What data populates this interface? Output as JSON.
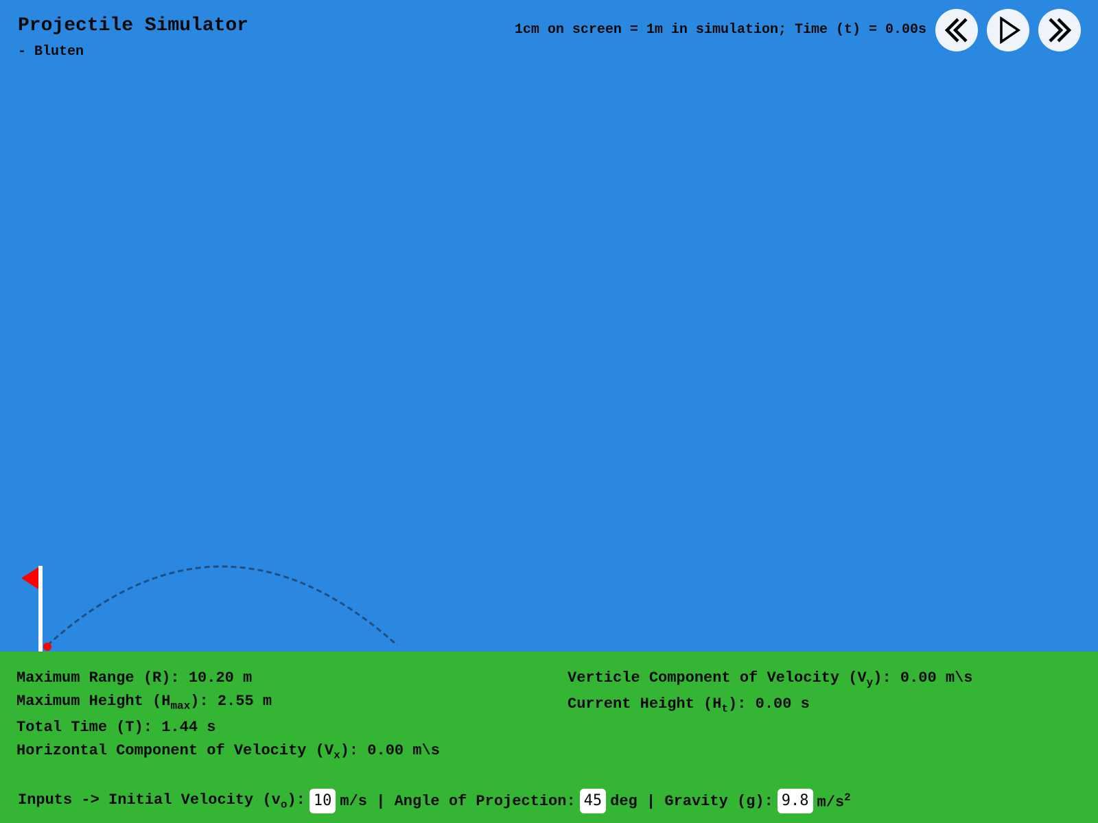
{
  "header": {
    "title": "Projectile Simulator",
    "author": "- Bluten",
    "status": "1cm on screen = 1m in simulation; Time (t) = 0.00s"
  },
  "controls": [
    {
      "icon": "double-chevron-left-icon"
    },
    {
      "icon": "play-icon"
    },
    {
      "icon": "double-chevron-right-icon"
    }
  ],
  "colors": {
    "sky": "#2B88E0",
    "ground": "#34B534",
    "flag": "#FF0000",
    "trajectory": "#1F4E80",
    "projectile": "#FF0000"
  },
  "stats": {
    "range_label": "Maximum Range (R): 10.20 m",
    "height_prefix": "Maximum Height (H",
    "height_sub": "max",
    "height_suffix": "): 2.55 m",
    "time_label": "Total Time (T): 1.44 s",
    "vx_prefix": "Horizontal Component of Velocity (V",
    "vx_sub": "x",
    "vx_suffix": "): 0.00 m\\s",
    "vy_prefix": "Verticle Component of Velocity (V",
    "vy_sub": "y",
    "vy_suffix": "): 0.00 m\\s",
    "ht_prefix": "Current Height (H",
    "ht_sub": "t",
    "ht_suffix": "): 0.00 s"
  },
  "inputs": {
    "prefix": "Inputs -> Initial Velocity (v",
    "v_sub": "o",
    "v_after": "):",
    "velocity_value": "10",
    "velocity_unit": "m/s | Angle of Projection:",
    "angle_value": "45",
    "angle_unit": "deg | Gravity (g):",
    "gravity_value": "9.8",
    "gravity_unit": "m/s",
    "gravity_sup": "2"
  }
}
